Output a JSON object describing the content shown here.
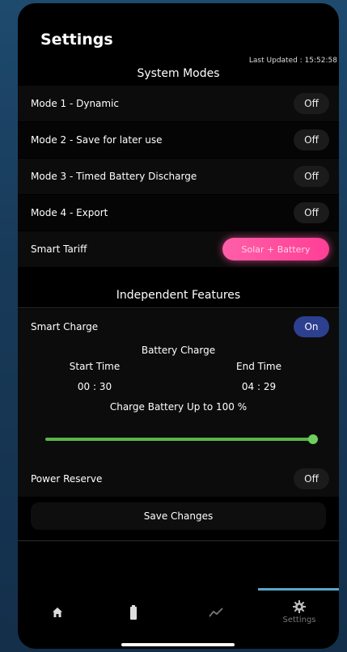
{
  "header": {
    "title": "Settings",
    "last_updated": "Last Updated : 15:52:58"
  },
  "system_modes": {
    "heading": "System Modes",
    "rows": [
      {
        "label": "Mode 1 - Dynamic",
        "value": "Off"
      },
      {
        "label": "Mode 2 - Save for later use",
        "value": "Off"
      },
      {
        "label": "Mode 3 - Timed Battery Discharge",
        "value": "Off"
      },
      {
        "label": "Mode 4 - Export",
        "value": "Off"
      }
    ],
    "smart_tariff": {
      "label": "Smart Tariff",
      "value": "Solar + Battery"
    }
  },
  "independent": {
    "heading": "Independent Features",
    "smart_charge": {
      "label": "Smart Charge",
      "value": "On"
    },
    "battery_charge": {
      "heading": "Battery Charge",
      "start_label": "Start Time",
      "start_value": "00 : 30",
      "end_label": "End Time",
      "end_value": "04 : 29",
      "charge_text": "Charge Battery Up to 100 %",
      "slider_percent": 100
    },
    "power_reserve": {
      "label": "Power Reserve",
      "value": "Off"
    },
    "save_label": "Save Changes"
  },
  "tabbar": {
    "settings_label": "Settings",
    "active": "settings"
  },
  "colors": {
    "accent_on": "#2d3f8f",
    "pink": "#ff4f9e",
    "slider": "#5ab54a",
    "tab_active": "#5aa7c9"
  }
}
